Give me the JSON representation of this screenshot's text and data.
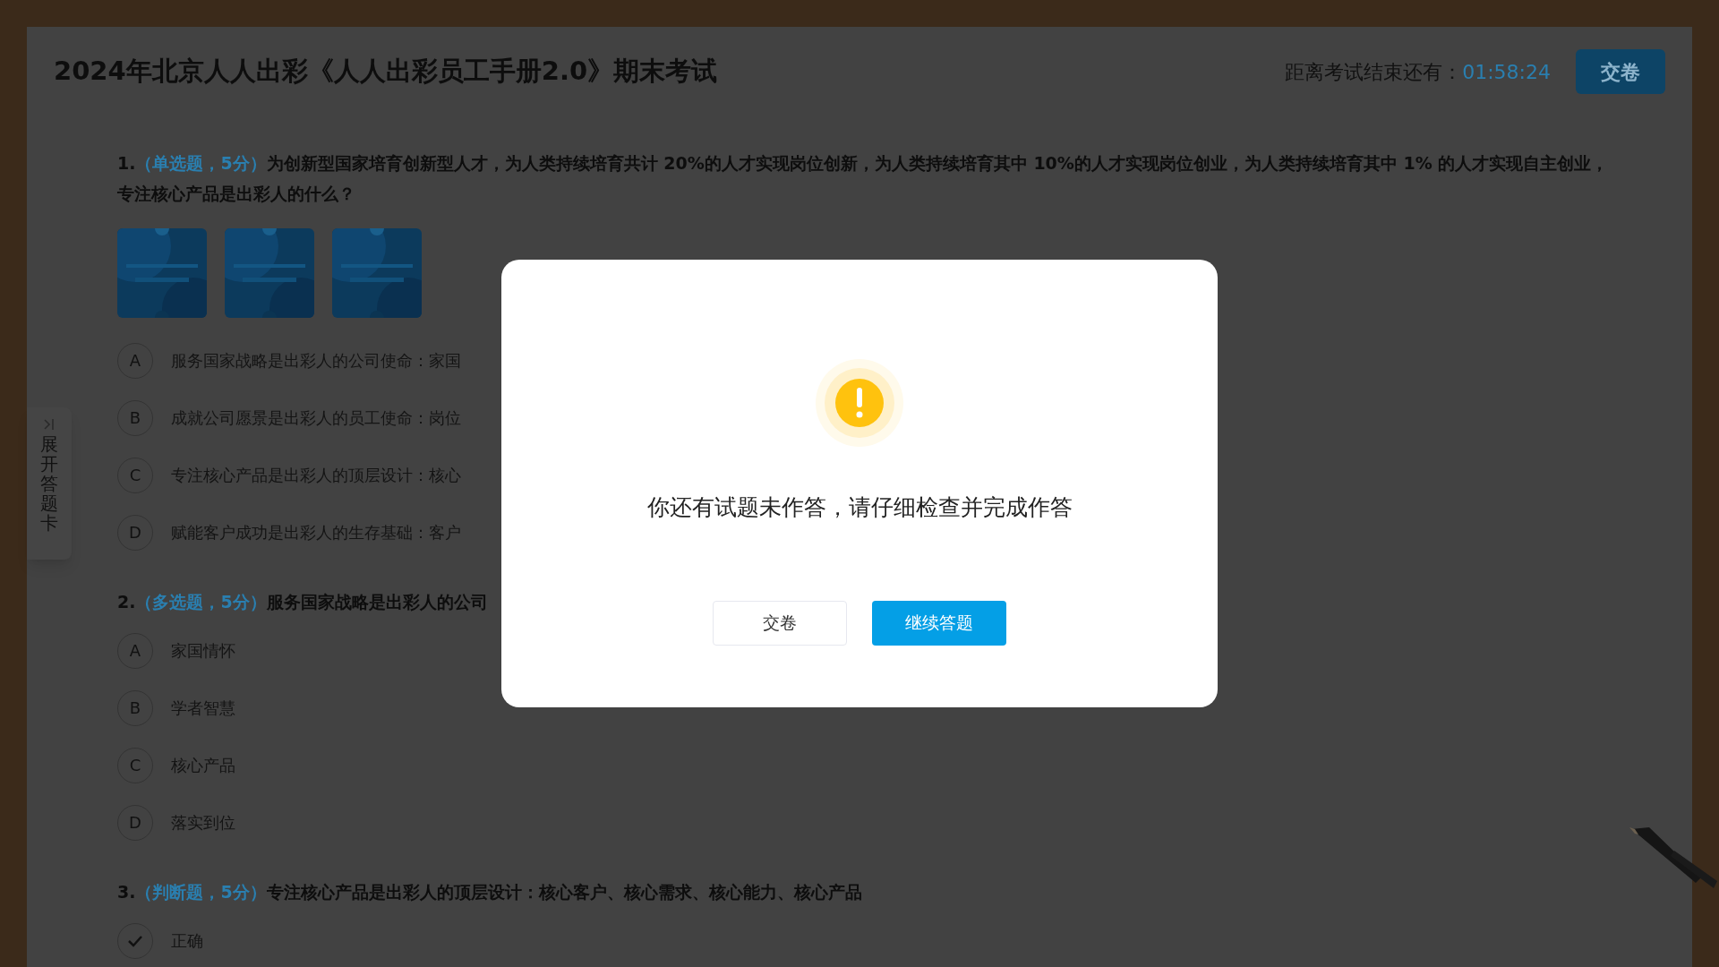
{
  "exam": {
    "title": "2024年北京人人出彩《人人出彩员工手册2.0》期末考试",
    "timer_label": "距离考试结束还有：",
    "timer_value": "01:58:24",
    "submit_button": "交卷"
  },
  "side_tab": {
    "label": "展开答题卡"
  },
  "questions": [
    {
      "number": "1.",
      "type_tag": "（单选题，5分）",
      "text": "为创新型国家培育创新型人才，为人类持续培育共计 20%的人才实现岗位创新，为人类持续培育其中 10%的人才实现岗位创业，为人类持续培育其中 1% 的人才实现自主创业，专注核心产品是出彩人的什么？",
      "options": [
        {
          "kind": "letter",
          "letter": "A",
          "text": "服务国家战略是出彩人的公司使命：家国"
        },
        {
          "kind": "letter",
          "letter": "B",
          "text": "成就公司愿景是出彩人的员工使命：岗位"
        },
        {
          "kind": "letter",
          "letter": "C",
          "text": "专注核心产品是出彩人的顶层设计：核心"
        },
        {
          "kind": "letter",
          "letter": "D",
          "text": "赋能客户成功是出彩人的生存基础：客户"
        }
      ]
    },
    {
      "number": "2.",
      "type_tag": "（多选题，5分）",
      "text": "服务国家战略是出彩人的公司",
      "options": [
        {
          "kind": "letter",
          "letter": "A",
          "text": "家国情怀"
        },
        {
          "kind": "letter",
          "letter": "B",
          "text": "学者智慧"
        },
        {
          "kind": "letter",
          "letter": "C",
          "text": "核心产品"
        },
        {
          "kind": "letter",
          "letter": "D",
          "text": "落实到位"
        }
      ]
    },
    {
      "number": "3.",
      "type_tag": "（判断题，5分）",
      "text": "专注核心产品是出彩人的顶层设计：核心客户、核心需求、核心能力、核心产品",
      "options": [
        {
          "kind": "check",
          "text": "正确"
        }
      ]
    }
  ],
  "dialog": {
    "message": "你还有试题未作答，请仔细检查并完成作答",
    "buttons": [
      {
        "kind": "secondary",
        "label": "交卷"
      },
      {
        "kind": "primary",
        "label": "继续答题"
      }
    ]
  }
}
